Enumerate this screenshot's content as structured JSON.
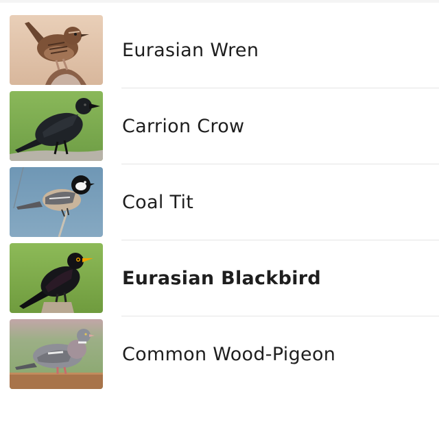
{
  "birds": [
    {
      "name": "Eurasian Wren",
      "thumbnail_icon": "eurasian-wren-photo",
      "selected": false
    },
    {
      "name": "Carrion Crow",
      "thumbnail_icon": "carrion-crow-photo",
      "selected": false
    },
    {
      "name": "Coal Tit",
      "thumbnail_icon": "coal-tit-photo",
      "selected": false
    },
    {
      "name": "Eurasian Blackbird",
      "thumbnail_icon": "eurasian-blackbird-photo",
      "selected": true
    },
    {
      "name": "Common Wood-Pigeon",
      "thumbnail_icon": "common-wood-pigeon-photo",
      "selected": false
    }
  ],
  "colors": {
    "text": "#1e1e1e",
    "divider": "#e4e4e4",
    "background": "#ffffff"
  }
}
